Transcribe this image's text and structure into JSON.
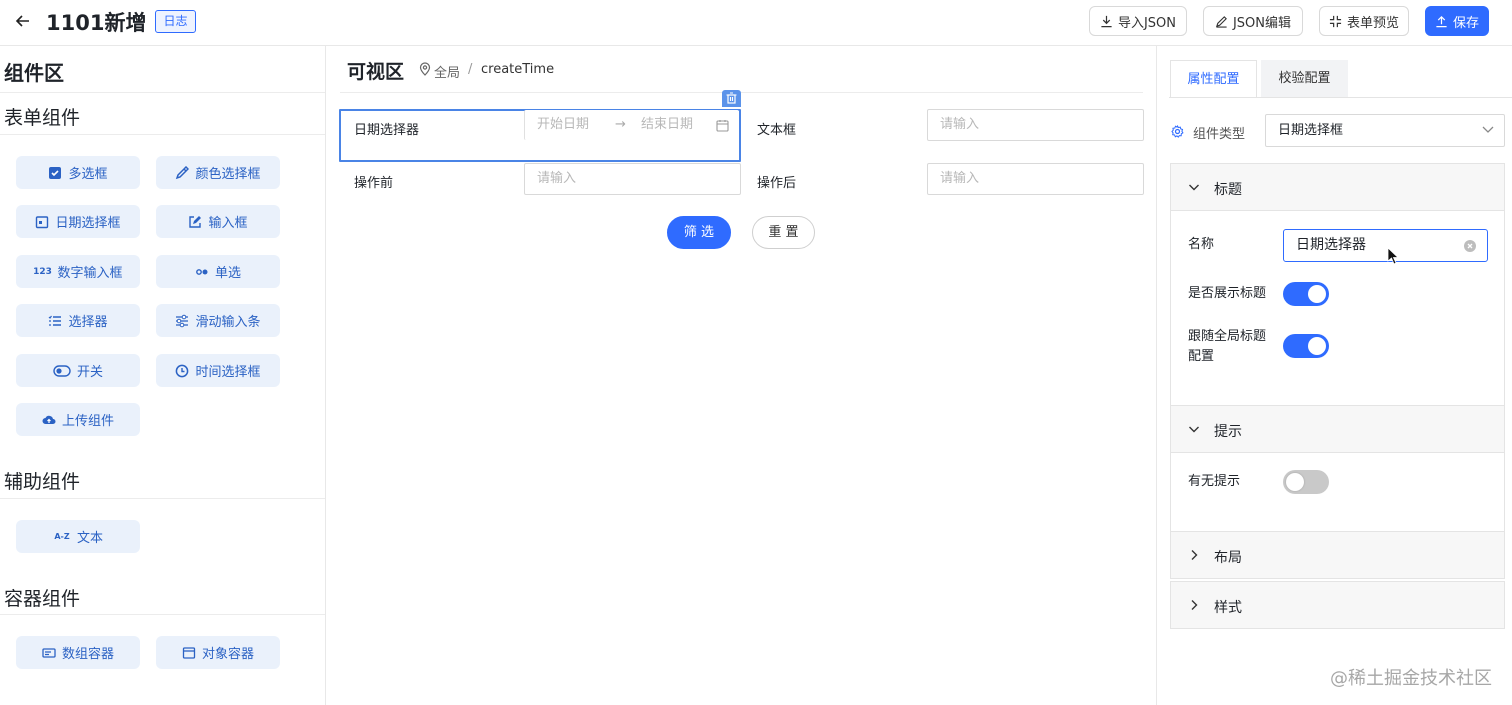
{
  "header": {
    "title": "1101新增",
    "tag": "日志",
    "buttons": {
      "import_json": "导入JSON",
      "json_edit": "JSON编辑",
      "form_preview": "表单预览",
      "save": "保存"
    }
  },
  "left": {
    "title": "组件区",
    "sections": {
      "form": {
        "title": "表单组件",
        "items": [
          "多选框",
          "颜色选择框",
          "日期选择框",
          "输入框",
          "数字输入框",
          "单选",
          "选择器",
          "滑动输入条",
          "开关",
          "时间选择框",
          "上传组件"
        ]
      },
      "aux": {
        "title": "辅助组件",
        "items": [
          "文本"
        ]
      },
      "container": {
        "title": "容器组件",
        "items": [
          "数组容器",
          "对象容器"
        ]
      }
    },
    "icon_text": {
      "number": "123",
      "az": "A-Z"
    }
  },
  "middle": {
    "title": "可视区",
    "breadcrumb": {
      "scope": "全局",
      "separator": "/",
      "field": "createTime"
    },
    "fields": {
      "date_picker": {
        "label": "日期选择器",
        "start_placeholder": "开始日期",
        "arrow": "→",
        "end_placeholder": "结束日期"
      },
      "text": {
        "label": "文本框",
        "placeholder": "请输入"
      },
      "before": {
        "label": "操作前",
        "placeholder": "请输入"
      },
      "after": {
        "label": "操作后",
        "placeholder": "请输入"
      }
    },
    "filter_button": "筛 选",
    "reset_button": "重 置"
  },
  "right": {
    "tabs": {
      "props": "属性配置",
      "validate": "校验配置"
    },
    "component_type": {
      "label": "组件类型",
      "value": "日期选择框"
    },
    "panels": {
      "title": {
        "header": "标题",
        "name_label": "名称",
        "name_value": "日期选择器",
        "show_title_label": "是否展示标题",
        "show_title": true,
        "follow_global_label_line1": "跟随全局标题",
        "follow_global_label_line2": "配置",
        "follow_global": true
      },
      "hint": {
        "header": "提示",
        "has_hint_label": "有无提示",
        "has_hint": false
      },
      "layout": {
        "header": "布局"
      },
      "style": {
        "header": "样式"
      }
    }
  },
  "watermark": "@稀土掘金技术社区",
  "colors": {
    "primary": "#2f6bff",
    "component_bg": "#eaf1fb",
    "component_text": "#2b62c4",
    "selected_border": "#4a84e6"
  }
}
